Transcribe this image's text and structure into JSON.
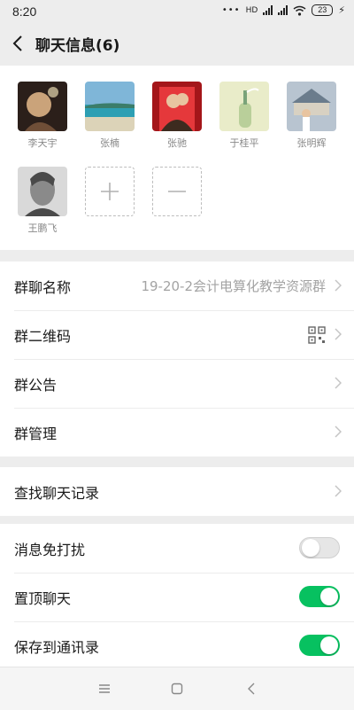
{
  "status_bar": {
    "time": "8:20",
    "battery": "23",
    "hd": "HD"
  },
  "header": {
    "title": "聊天信息(6)"
  },
  "members": [
    {
      "name": "李天宇",
      "palette": [
        "#2b1f1a",
        "#caa37a",
        "#6f4e37"
      ]
    },
    {
      "name": "张楠",
      "palette": [
        "#7fb6d8",
        "#2d9fb3",
        "#dcd3b8"
      ]
    },
    {
      "name": "张驰",
      "palette": [
        "#a4161a",
        "#e5383b",
        "#3d2b1f"
      ]
    },
    {
      "name": "于桂平",
      "palette": [
        "#e9ecc9",
        "#b9cf9a",
        "#7aa37a"
      ]
    },
    {
      "name": "张明辉",
      "palette": [
        "#b8c4d0",
        "#6b7c8c",
        "#d8d1c2"
      ]
    },
    {
      "name": "王鹏飞",
      "palette": [
        "#d9d9d9",
        "#8a8a8a",
        "#4a4a4a"
      ]
    }
  ],
  "member_actions": [
    {
      "name": "add",
      "glyph": "+"
    },
    {
      "name": "remove",
      "glyph": "—"
    }
  ],
  "group_section": {
    "name_label": "群聊名称",
    "name_value": "19-20-2会计电算化教学资源群",
    "qr_label": "群二维码",
    "notice_label": "群公告",
    "manage_label": "群管理"
  },
  "search_section": {
    "label": "查找聊天记录"
  },
  "settings_section": [
    {
      "label": "消息免打扰",
      "state": "off"
    },
    {
      "label": "置顶聊天",
      "state": "on"
    },
    {
      "label": "保存到通讯录",
      "state": "on"
    }
  ],
  "colors": {
    "accent": "#07c160",
    "background": "#ededed"
  },
  "nav_icons": [
    "menu-icon",
    "home-icon",
    "back-icon"
  ]
}
